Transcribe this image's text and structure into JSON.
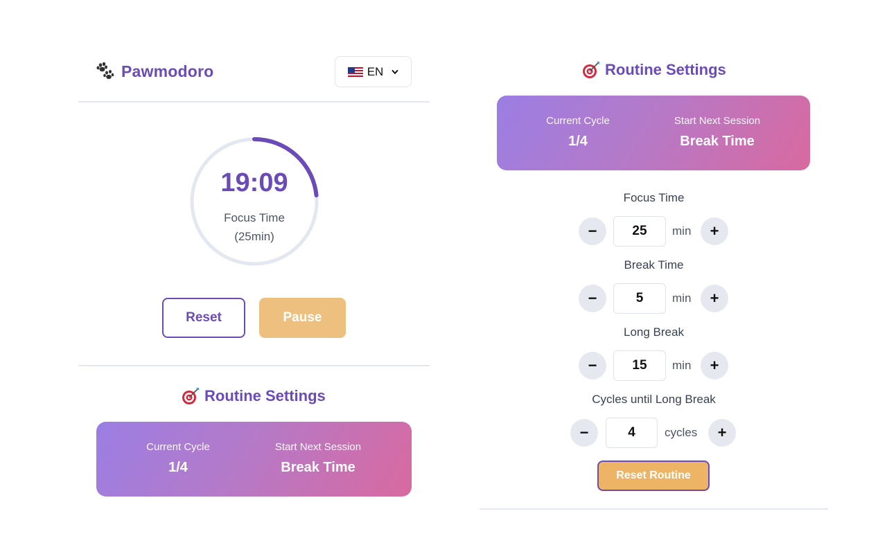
{
  "app": {
    "title": "Pawmodoro",
    "language": {
      "selected": "EN",
      "flag": "us-flag-icon"
    }
  },
  "timer": {
    "time": "19:09",
    "mode": "Focus Time",
    "duration": "(25min)",
    "progress_fraction": 0.234,
    "colors": {
      "progress": "#6a4bb8",
      "track": "#e3e7f0"
    }
  },
  "controls": {
    "reset_label": "Reset",
    "pause_label": "Pause"
  },
  "routine_left": {
    "title": "Routine Settings",
    "current_cycle_label": "Current Cycle",
    "current_cycle_value": "1/4",
    "next_session_label": "Start Next Session",
    "next_session_value": "Break Time"
  },
  "routine_right": {
    "title": "Routine Settings",
    "current_cycle_label": "Current Cycle",
    "current_cycle_value": "1/4",
    "next_session_label": "Start Next Session",
    "next_session_value": "Break Time",
    "settings": [
      {
        "label": "Focus Time",
        "value": "25",
        "unit": "min"
      },
      {
        "label": "Break Time",
        "value": "5",
        "unit": "min"
      },
      {
        "label": "Long Break",
        "value": "15",
        "unit": "min"
      },
      {
        "label": "Cycles until Long Break",
        "value": "4",
        "unit": "cycles"
      }
    ],
    "decrement_symbol": "−",
    "increment_symbol": "+",
    "reset_routine_label": "Reset Routine"
  },
  "colors": {
    "accent": "#6a4bb8",
    "pause_button": "#eec07f",
    "reset_routine_button": "#eeb466",
    "card_gradient_start": "#9b7ee3",
    "card_gradient_end": "#d9699f"
  }
}
